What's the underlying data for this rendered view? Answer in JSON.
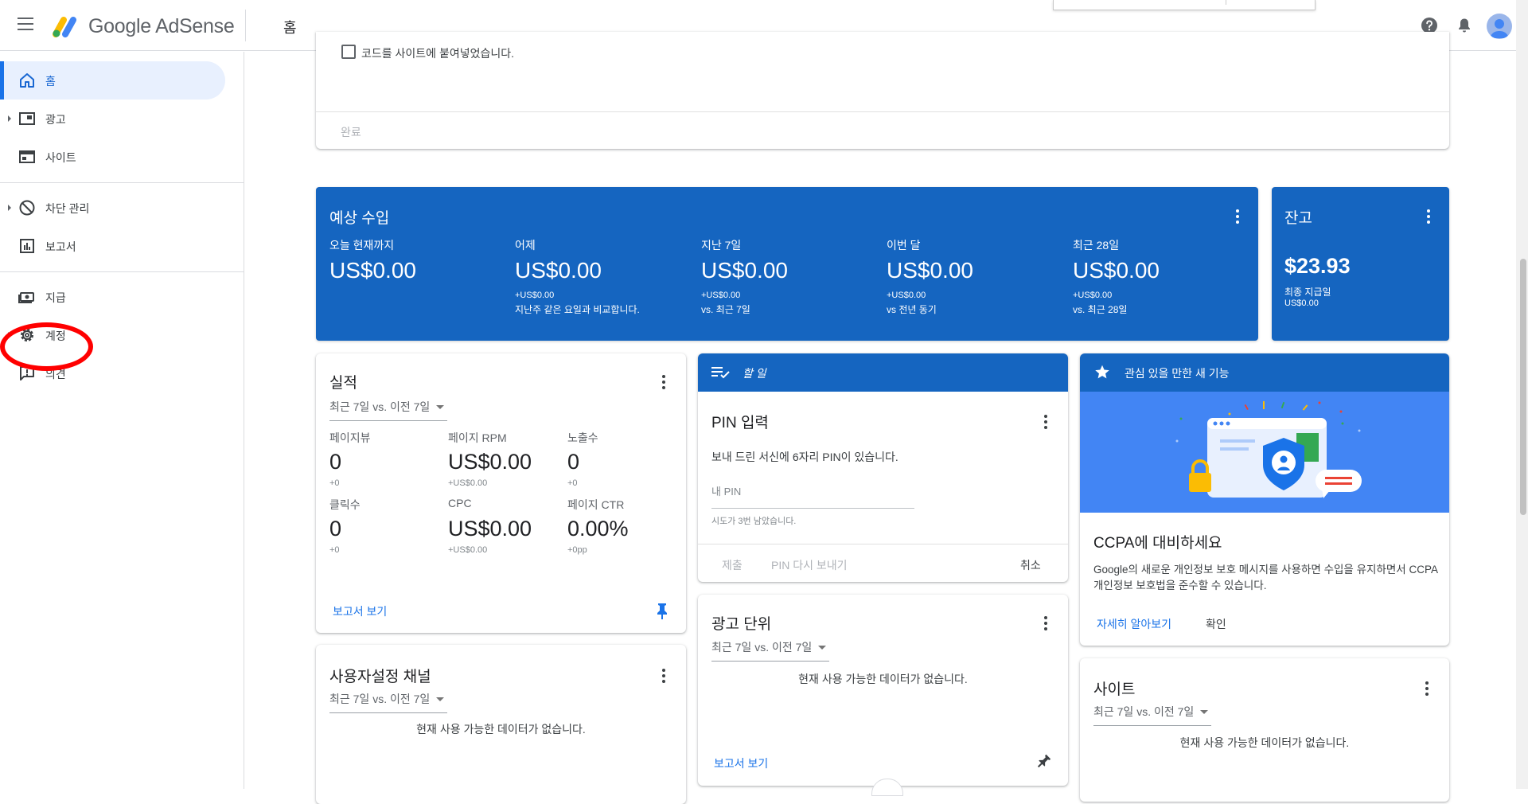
{
  "app": {
    "brand": "Google AdSense",
    "breadcrumb": "홈"
  },
  "sidebar": {
    "items": [
      {
        "label": "홈"
      },
      {
        "label": "광고"
      },
      {
        "label": "사이트"
      },
      {
        "label": "차단 관리"
      },
      {
        "label": "보고서"
      },
      {
        "label": "지급"
      },
      {
        "label": "계정"
      },
      {
        "label": "의견"
      }
    ],
    "active": "홈",
    "highlight_color": "#ff0000"
  },
  "setup": {
    "checkbox_label": "코드를 사이트에 붙여넣었습니다.",
    "done_label": "완료"
  },
  "earnings": {
    "title": "예상 수입",
    "columns": [
      {
        "label": "오늘 현재까지",
        "value": "US$0.00",
        "delta": "",
        "note": ""
      },
      {
        "label": "어제",
        "value": "US$0.00",
        "delta": "+US$0.00",
        "note": "지난주 같은 요일과 비교합니다."
      },
      {
        "label": "지난 7일",
        "value": "US$0.00",
        "delta": "+US$0.00",
        "note": "vs. 최근 7일"
      },
      {
        "label": "이번 달",
        "value": "US$0.00",
        "delta": "+US$0.00",
        "note": "vs 전년 동기"
      },
      {
        "label": "최근 28일",
        "value": "US$0.00",
        "delta": "+US$0.00",
        "note": "vs. 최근 28일"
      }
    ]
  },
  "balance": {
    "title": "잔고",
    "value": "$23.93",
    "last_payment_label": "최종 지급일",
    "last_payment_value": "US$0.00"
  },
  "performance": {
    "title": "실적",
    "range": "최근 7일 vs. 이전 7일",
    "metrics": [
      {
        "label": "페이지뷰",
        "value": "0",
        "delta": "+0"
      },
      {
        "label": "페이지 RPM",
        "value": "US$0.00",
        "delta": "+US$0.00"
      },
      {
        "label": "노출수",
        "value": "0",
        "delta": "+0"
      },
      {
        "label": "클릭수",
        "value": "0",
        "delta": "+0"
      },
      {
        "label": "CPC",
        "value": "US$0.00",
        "delta": "+US$0.00"
      },
      {
        "label": "페이지 CTR",
        "value": "0.00%",
        "delta": "+0pp"
      }
    ],
    "report_link": "보고서 보기"
  },
  "custom_channels": {
    "title": "사용자설정 채널",
    "range": "최근 7일 vs. 이전 7일",
    "empty": "현재 사용 가능한 데이터가 없습니다."
  },
  "todo": {
    "header": "할 일",
    "title": "PIN 입력",
    "body": "보내 드린 서신에 6자리 PIN이 있습니다.",
    "pin_placeholder": "내 PIN",
    "attempts": "시도가 3번 남았습니다.",
    "submit": "제출",
    "resend": "PIN 다시 보내기",
    "cancel": "취소"
  },
  "ad_units": {
    "title": "광고 단위",
    "range": "최근 7일 vs. 이전 7일",
    "empty": "현재 사용 가능한 데이터가 없습니다.",
    "report_link": "보고서 보기"
  },
  "new_features": {
    "header": "관심 있을 만한 새 기능",
    "title": "CCPA에 대비하세요",
    "body": "Google의 새로운 개인정보 보호 메시지를 사용하면 수입을 유지하면서 CCPA 개인정보 보호법을 준수할 수 있습니다.",
    "learn_more": "자세히 알아보기",
    "confirm": "확인"
  },
  "sites": {
    "title": "사이트",
    "range": "최근 7일 vs. 이전 7일",
    "empty": "현재 사용 가능한 데이터가 없습니다."
  },
  "colors": {
    "accent_blue": "#1565c0",
    "link_blue": "#1a73e8",
    "illustration_blue": "#4285f4"
  }
}
